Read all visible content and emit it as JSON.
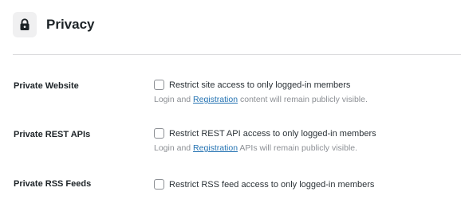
{
  "header": {
    "icon": "lock-icon",
    "title": "Privacy"
  },
  "settings": [
    {
      "label": "Private Website",
      "checkbox_label": "Restrict site access to only logged-in members",
      "checked": false,
      "desc_prefix": "Login and ",
      "desc_link": "Registration",
      "desc_suffix": " content will remain publicly visible."
    },
    {
      "label": "Private REST APIs",
      "checkbox_label": "Restrict REST API access to only logged-in members",
      "checked": false,
      "desc_prefix": "Login and ",
      "desc_link": "Registration",
      "desc_suffix": " APIs will remain publicly visible."
    },
    {
      "label": "Private RSS Feeds",
      "checkbox_label": "Restrict RSS feed access to only logged-in members",
      "checked": false
    }
  ],
  "colors": {
    "link": "#2271b1",
    "muted_text": "#8c8f94",
    "icon_bg": "#f0f0f1",
    "divider": "#dcdcde"
  }
}
